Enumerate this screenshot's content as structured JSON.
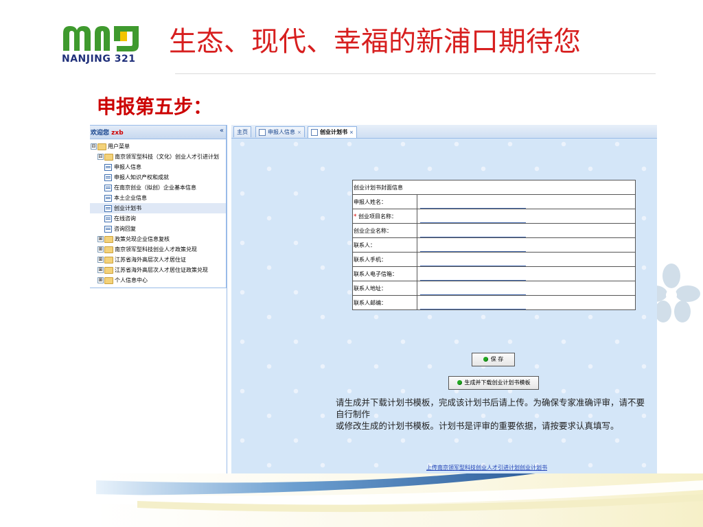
{
  "slide": {
    "logo_mark": "mnj",
    "logo_text": "NANJING 321",
    "title": "生态、现代、幸福的新浦口期待您",
    "step_title": "申报第五步："
  },
  "app": {
    "left_panel": {
      "welcome": "欢迎您",
      "user": "zxb",
      "collapse": "«",
      "tree": [
        {
          "toggle": "⊟",
          "folder": true,
          "label": "用户菜单",
          "indent": 0
        },
        {
          "toggle": "⊟",
          "folder": true,
          "label": "南京领军型科技（文化）创业人才引进计划",
          "indent": 1
        },
        {
          "leaf": true,
          "label": "申报人信息",
          "indent": 2
        },
        {
          "leaf": true,
          "label": "申报人知识产权和成就",
          "indent": 2
        },
        {
          "leaf": true,
          "label": "在南京创业（拟创）企业基本信息",
          "indent": 2
        },
        {
          "leaf": true,
          "label": "本土企业信息",
          "indent": 2
        },
        {
          "leaf": true,
          "label": "创业计划书",
          "indent": 2,
          "selected": true
        },
        {
          "leaf": true,
          "label": "在线咨询",
          "indent": 2
        },
        {
          "leaf": true,
          "label": "咨询回复",
          "indent": 2
        },
        {
          "toggle": "⊞",
          "folder": true,
          "label": "政策兑现企业信息复核",
          "indent": 1
        },
        {
          "toggle": "⊞",
          "folder": true,
          "label": "南京领军型科技创业人才政策兑现",
          "indent": 1
        },
        {
          "toggle": "⊞",
          "folder": true,
          "label": "江苏省海外高层次人才居住证",
          "indent": 1
        },
        {
          "toggle": "⊞",
          "folder": true,
          "label": "江苏省海外高层次人才居住证政策兑现",
          "indent": 1
        },
        {
          "toggle": "⊞",
          "folder": true,
          "label": "个人信息中心",
          "indent": 1
        }
      ]
    },
    "tabs": [
      {
        "label": "主页"
      },
      {
        "label": "申报人信息",
        "close": "×"
      },
      {
        "label": "创业计划书",
        "close": "×",
        "active": true
      }
    ],
    "form": {
      "header": "创业计划书封面信息",
      "rows": [
        {
          "label": "申报人姓名：",
          "required": false
        },
        {
          "label": "创业项目名称：",
          "required": true
        },
        {
          "label": "创业企业名称：",
          "required": false
        },
        {
          "label": "联系人：",
          "required": false
        },
        {
          "label": "联系人手机：",
          "required": false
        },
        {
          "label": "联系人电子信箱：",
          "required": false
        },
        {
          "label": "联系人地址：",
          "required": false
        },
        {
          "label": "联系人邮编：",
          "required": false
        }
      ],
      "required_mark": "*"
    },
    "buttons": {
      "save": "保 存",
      "generate": "生成并下载创业计划书模板"
    },
    "note_line1": "请生成并下载计划书模板，完成该计划书后请上传。为确保专家准确评审，请不要自行制作",
    "note_line2": "或修改生成的计划书模板。计划书是评审的重要依据，请按要求认真填写。",
    "upload_link": "上传南京领军型科技创业人才引进计划创业计划书"
  }
}
